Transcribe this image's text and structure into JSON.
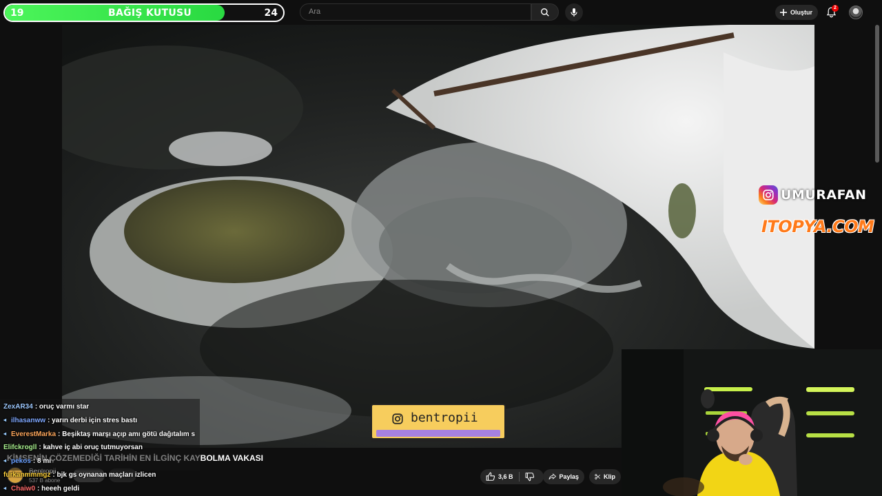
{
  "donation": {
    "title": "BAĞIŞ KUTUSU",
    "left_value": "19",
    "right_value": "24",
    "fill_fraction": 0.79
  },
  "search": {
    "placeholder": "Ara"
  },
  "header": {
    "create_label": "Oluştur",
    "notification_count": "2"
  },
  "overlay": {
    "instagram_handle": "UMURAFAN",
    "sponsor": "ITOPYA.COM",
    "card_handle": "bentropii"
  },
  "video": {
    "title": "KİMSENİN ÇÖZEMEDİĞİ TARİHİN EN İLGİNÇ KAYBOLMA VAKASI",
    "channel_name": "Bentropii",
    "subscribers": "537 B abone",
    "likes": "3,6 B",
    "share_label": "Paylaş",
    "clip_label": "Klip"
  },
  "chat": {
    "messages": [
      {
        "user": "ZexAR34",
        "text": ": oruç varmı star",
        "color": "#9ec9ff"
      },
      {
        "user": "ilhasanww",
        "text": ": yarın derbi için stres bastı",
        "color": "#7fa8ff"
      },
      {
        "user": "EverestMarka",
        "text": ": Beşiktaş marşı açıp amı götü dağıtalım s",
        "color": "#ffa85c"
      },
      {
        "user": "Elifckrogll",
        "text": ": kahve iç abi oruç tutmuyorsan",
        "color": "#a8f08e"
      },
      {
        "user": "pekos",
        "text": ": 8 mi",
        "color": "#6aa0ff"
      },
      {
        "user": "furkanmmmgz",
        "text": ": bjk gs oynanan maçları izlicen",
        "color": "#ffd23b"
      },
      {
        "user": "Chaiw0",
        "text": ": heeeh geldi",
        "color": "#ff6a6a"
      }
    ]
  },
  "colors": {
    "donation_fill": "#3de94f",
    "card_bg": "#f7cd5d",
    "card_strip": "#a681e0",
    "sponsor_orange": "#ff7a1a"
  }
}
